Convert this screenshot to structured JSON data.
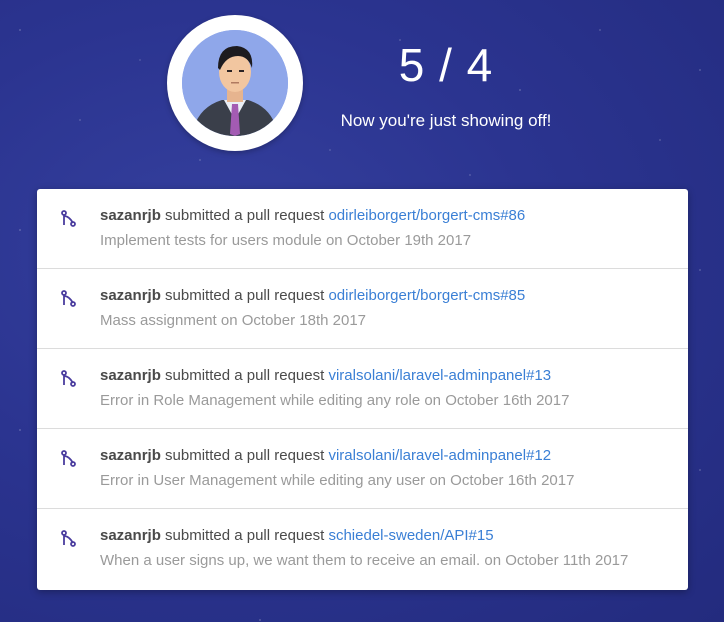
{
  "score": {
    "text": "5 / 4"
  },
  "message": "Now you're just showing off!",
  "colors": {
    "background": "#2b3490",
    "link": "#3a7fd5",
    "icon": "#4a3c9e"
  },
  "pull_requests": [
    {
      "user": "sazanrjb",
      "action": "submitted a pull request",
      "repo_link": "odirleiborgert/borgert-cms#86",
      "title": "Implement tests for users module",
      "date_text": "on October 19th 2017"
    },
    {
      "user": "sazanrjb",
      "action": "submitted a pull request",
      "repo_link": "odirleiborgert/borgert-cms#85",
      "title": "Mass assignment",
      "date_text": "on October 18th 2017"
    },
    {
      "user": "sazanrjb",
      "action": "submitted a pull request",
      "repo_link": "viralsolani/laravel-adminpanel#13",
      "title": "Error in Role Management while editing any role",
      "date_text": "on October 16th 2017"
    },
    {
      "user": "sazanrjb",
      "action": "submitted a pull request",
      "repo_link": "viralsolani/laravel-adminpanel#12",
      "title": "Error in User Management while editing any user",
      "date_text": "on October 16th 2017"
    },
    {
      "user": "sazanrjb",
      "action": "submitted a pull request",
      "repo_link": "schiedel-sweden/API#15",
      "title": "When a user signs up, we want them to receive an email.",
      "date_text": "on October 11th 2017"
    }
  ]
}
